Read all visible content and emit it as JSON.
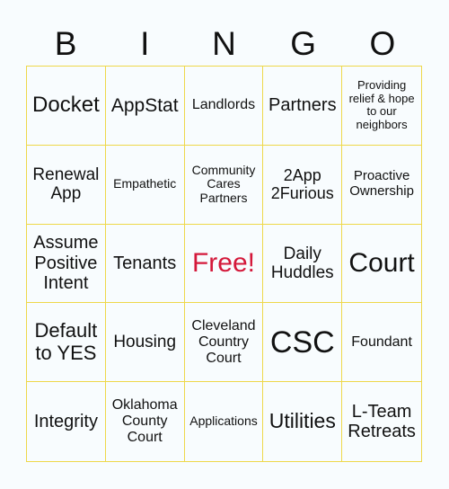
{
  "header": [
    "B",
    "I",
    "N",
    "G",
    "O"
  ],
  "free_color": "#d4183a",
  "line_color": "#eed84a",
  "cells": [
    {
      "text": "Docket",
      "size": 24
    },
    {
      "text": "AppStat",
      "size": 21
    },
    {
      "text": "Landlords",
      "size": 16
    },
    {
      "text": "Partners",
      "size": 20
    },
    {
      "text": "Providing relief & hope to our neighbors",
      "size": 13
    },
    {
      "text": "Renewal App",
      "size": 19
    },
    {
      "text": "Empathetic",
      "size": 14
    },
    {
      "text": "Community Cares Partners",
      "size": 14
    },
    {
      "text": "2App 2Furious",
      "size": 18
    },
    {
      "text": "Proactive Ownership",
      "size": 15
    },
    {
      "text": "Assume Positive Intent",
      "size": 20
    },
    {
      "text": "Tenants",
      "size": 20
    },
    {
      "text": "Free!",
      "size": 30,
      "free": true
    },
    {
      "text": "Daily Huddles",
      "size": 19
    },
    {
      "text": "Court",
      "size": 30
    },
    {
      "text": "Default to YES",
      "size": 22
    },
    {
      "text": "Housing",
      "size": 19
    },
    {
      "text": "Cleveland Country Court",
      "size": 16
    },
    {
      "text": "CSC",
      "size": 34
    },
    {
      "text": "Foundant",
      "size": 16
    },
    {
      "text": "Integrity",
      "size": 20
    },
    {
      "text": "Oklahoma County Court",
      "size": 16
    },
    {
      "text": "Applications",
      "size": 14
    },
    {
      "text": "Utilities",
      "size": 23
    },
    {
      "text": "L-Team Retreats",
      "size": 20
    }
  ]
}
